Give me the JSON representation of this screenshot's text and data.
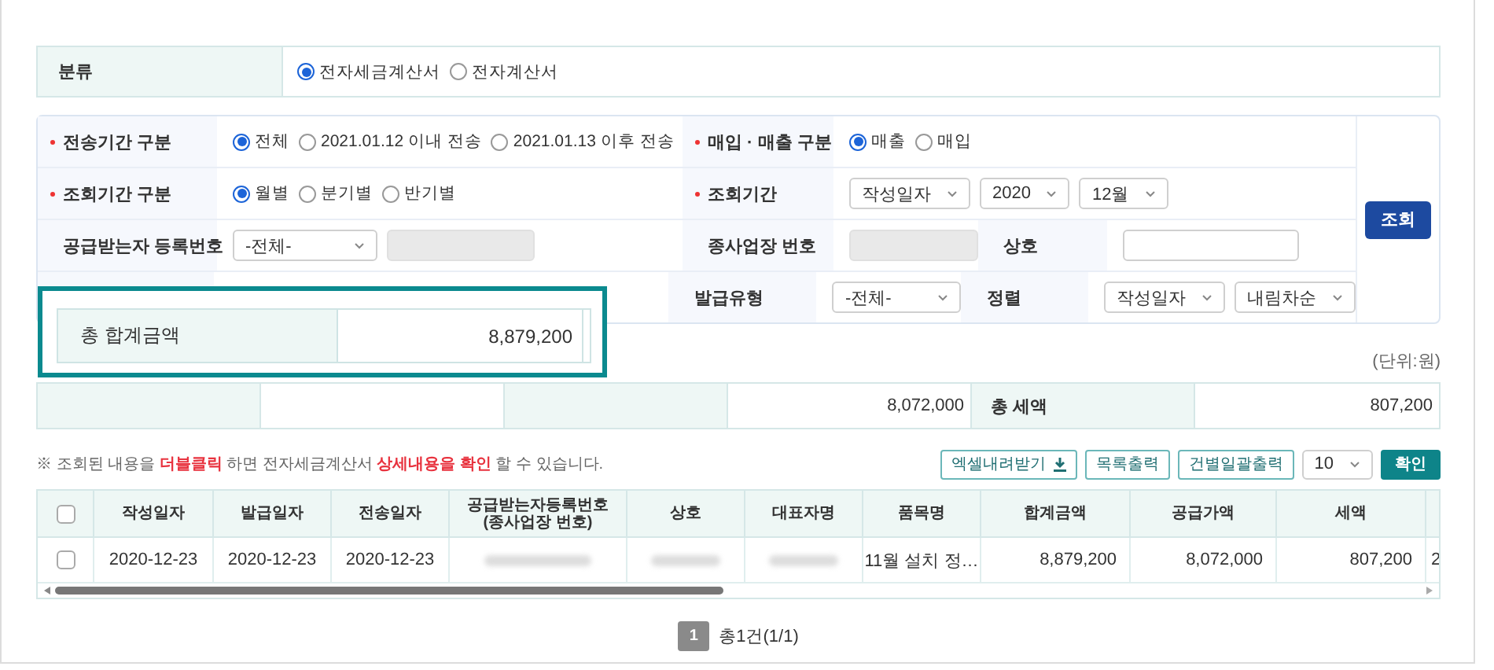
{
  "category": {
    "label": "분류",
    "options": [
      {
        "label": "전자세금계산서",
        "selected": true
      },
      {
        "label": "전자계산서",
        "selected": false
      }
    ]
  },
  "search": {
    "rows": [
      {
        "left": [
          {
            "kind": "label",
            "text": "전송기간 구분",
            "required": true
          },
          {
            "kind": "radios",
            "options": [
              {
                "label": "전체",
                "selected": true
              },
              {
                "label": "2021.01.12 이내 전송",
                "selected": false
              },
              {
                "label": "2021.01.13 이후 전송",
                "selected": false
              }
            ]
          }
        ],
        "right": [
          {
            "kind": "label",
            "text": "매입 · 매출 구분",
            "required": true
          },
          {
            "kind": "radios",
            "options": [
              {
                "label": "매출",
                "selected": true
              },
              {
                "label": "매입",
                "selected": false
              }
            ]
          }
        ]
      },
      {
        "left": [
          {
            "kind": "label",
            "text": "조회기간 구분",
            "required": true
          },
          {
            "kind": "radios",
            "options": [
              {
                "label": "월별",
                "selected": true
              },
              {
                "label": "분기별",
                "selected": false
              },
              {
                "label": "반기별",
                "selected": false
              }
            ]
          }
        ],
        "right": [
          {
            "kind": "label",
            "text": "조회기간",
            "required": true
          },
          {
            "kind": "controls",
            "items": [
              {
                "kind": "select",
                "value": "작성일자"
              },
              {
                "kind": "select",
                "value": "2020"
              },
              {
                "kind": "select",
                "value": "12월"
              }
            ]
          }
        ]
      },
      {
        "left": [
          {
            "kind": "label",
            "text": "공급받는자 등록번호",
            "required": false
          },
          {
            "kind": "controls",
            "items": [
              {
                "kind": "select",
                "value": "-전체-"
              },
              {
                "kind": "input",
                "disabled": true
              }
            ]
          }
        ],
        "right": [
          {
            "kind": "label",
            "text": "종사업장 번호",
            "required": false
          },
          {
            "kind": "controls",
            "items": [
              {
                "kind": "input",
                "disabled": true
              }
            ]
          },
          {
            "kind": "label",
            "text": "상호",
            "required": false
          },
          {
            "kind": "controls",
            "items": [
              {
                "kind": "input",
                "disabled": false
              }
            ]
          }
        ]
      },
      {
        "right": [
          {
            "kind": "label",
            "text": "발급유형",
            "required": false
          },
          {
            "kind": "controls",
            "items": [
              {
                "kind": "select",
                "value": "-전체-"
              }
            ]
          },
          {
            "kind": "label",
            "text": "정렬",
            "required": false
          },
          {
            "kind": "controls",
            "items": [
              {
                "kind": "select",
                "value": "작성일자"
              },
              {
                "kind": "select",
                "value": "내림차순"
              }
            ]
          }
        ]
      }
    ],
    "button": "조회"
  },
  "callout": {
    "label": "총 합계금액",
    "value": "8,879,200"
  },
  "totals": {
    "unit": "(단위:원)",
    "items": [
      {
        "value": "8,072,000"
      },
      {
        "label": "총 세액",
        "value": "807,200"
      }
    ]
  },
  "notice": [
    {
      "text": "※ 조회된 내용을 ",
      "highlight": false
    },
    {
      "text": "더블클릭",
      "highlight": true
    },
    {
      "text": " 하면 전자세금계산서 ",
      "highlight": false
    },
    {
      "text": "상세내용을 확인",
      "highlight": true
    },
    {
      "text": " 할 수 있습니다.",
      "highlight": false
    }
  ],
  "toolbar": {
    "buttons": [
      {
        "label": "엑셀내려받기",
        "kind": "download"
      },
      {
        "label": "목록출력",
        "kind": "plain"
      },
      {
        "label": "건별일괄출력",
        "kind": "plain"
      }
    ],
    "page_size": "10",
    "confirm": "확인"
  },
  "table": {
    "header_checked": false,
    "columns": [
      "작성일자",
      "발급일자",
      "전송일자",
      "공급받는자등록번호\n(종사업장 번호)",
      "상호",
      "대표자명",
      "품목명",
      "합계금액",
      "공급가액",
      "세액",
      ""
    ],
    "rows": [
      {
        "checked": false,
        "cells": [
          {
            "text": "2020-12-23"
          },
          {
            "text": "2020-12-23"
          },
          {
            "text": "2020-12-23"
          },
          {
            "kind": "redacted"
          },
          {
            "kind": "redacted"
          },
          {
            "kind": "redacted"
          },
          {
            "text": "11월 설치 정…"
          },
          {
            "text": "8,879,200"
          },
          {
            "text": "8,072,000"
          },
          {
            "text": "807,200"
          },
          {
            "text": "2"
          }
        ]
      }
    ]
  },
  "pagination": {
    "pages": [
      {
        "label": "1",
        "selected": true
      }
    ],
    "summary": "총1건(1/1)"
  }
}
